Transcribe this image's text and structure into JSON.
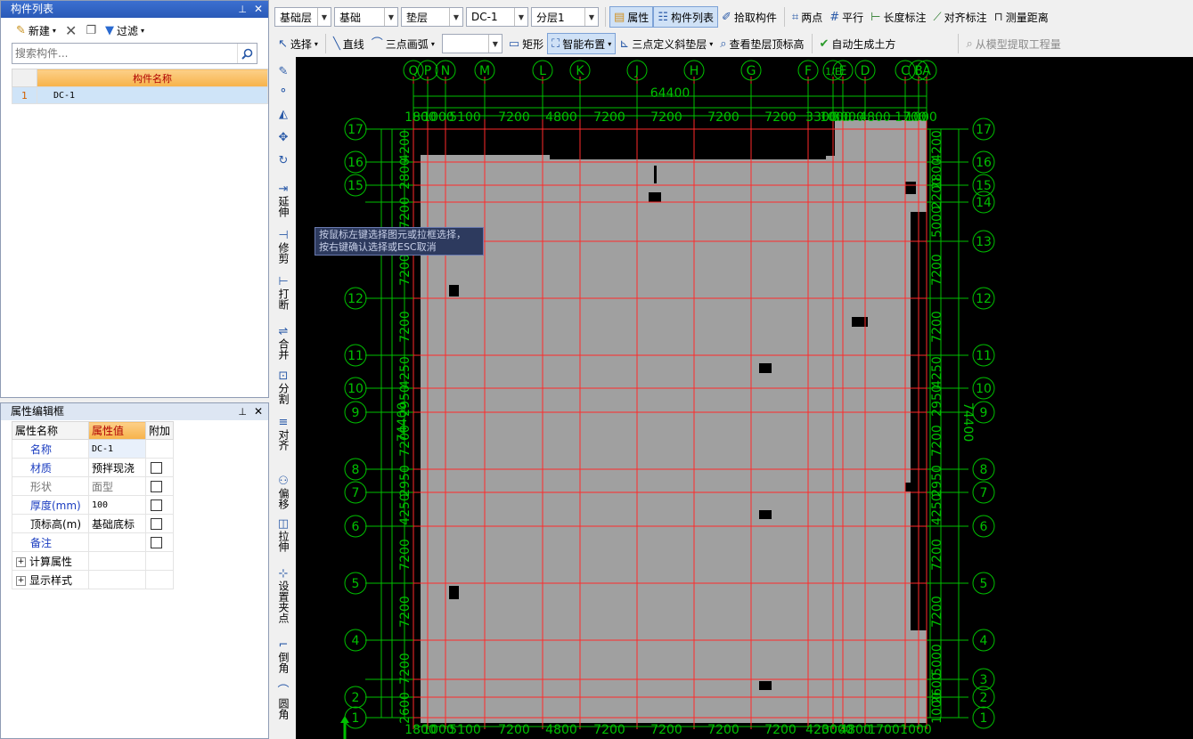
{
  "component_panel": {
    "title": "构件列表",
    "new_label": "新建",
    "filter_label": "过滤",
    "search_placeholder": "搜索构件...",
    "column_header": "构件名称",
    "rows": [
      {
        "index": "1",
        "name": "DC-1"
      }
    ]
  },
  "property_panel": {
    "title": "属性编辑框",
    "headers": {
      "name": "属性名称",
      "value": "属性值",
      "extra": "附加"
    },
    "rows": [
      {
        "name": "名称",
        "value": "DC-1"
      },
      {
        "name": "材质",
        "value": "预拌现浇"
      },
      {
        "name": "形状",
        "value": "面型"
      },
      {
        "name": "厚度(mm)",
        "value": "100"
      },
      {
        "name": "顶标高(m)",
        "value": "基础底标"
      },
      {
        "name": "备注",
        "value": ""
      }
    ],
    "groups": [
      "计算属性",
      "显示样式"
    ]
  },
  "toolbar1": {
    "floor_combo": "基础层",
    "type_combo": "基础",
    "category_combo": "垫层",
    "component_combo": "DC-1",
    "layer_combo": "分层1",
    "property_btn": "属性",
    "comp_list_btn": "构件列表",
    "pick_btn": "拾取构件",
    "two_point_btn": "两点",
    "parallel_btn": "平行",
    "length_dim_btn": "长度标注",
    "align_dim_btn": "对齐标注",
    "measure_btn": "测量距离"
  },
  "toolbar2": {
    "select_btn": "选择",
    "line_btn": "直线",
    "arc_btn": "三点画弧",
    "rect_btn": "矩形",
    "smart_layout_btn": "智能布置",
    "slope_btn": "三点定义斜垫层",
    "view_top_btn": "查看垫层顶标高",
    "auto_earth_btn": "自动生成土方",
    "extract_btn": "从模型提取工程量"
  },
  "vertical_tools": [
    "延伸",
    "修剪",
    "打断",
    "合并",
    "分割",
    "对齐",
    "偏移",
    "拉伸",
    "设置夹点",
    "倒角",
    "圆角"
  ],
  "tooltip": {
    "line1": "按鼠标左键选择图元或拉框选择，",
    "line2": "按右键确认选择或ESC取消"
  },
  "drawing": {
    "top_axes": [
      "Q",
      "P",
      "N",
      "M",
      "L",
      "K",
      "J",
      "H",
      "G",
      "F",
      "1/E",
      "E",
      "D",
      "C",
      "B",
      "A"
    ],
    "row_axes": [
      "17",
      "16",
      "15",
      "14",
      "13",
      "12",
      "11",
      "10",
      "9",
      "8",
      "7",
      "6",
      "5",
      "4",
      "3",
      "2",
      "1"
    ],
    "overall_width": "64400",
    "overall_height": "74400",
    "top_dims": [
      "1800",
      "1000",
      "5100",
      "7200",
      "4800",
      "7200",
      "7200",
      "7200",
      "7200",
      "3300",
      "1000",
      "3000",
      "4800",
      "1700",
      "1000"
    ],
    "bottom_dims": [
      "1800",
      "1000",
      "5100",
      "7200",
      "4800",
      "7200",
      "7200",
      "7200",
      "7200",
      "4200",
      "3000",
      "4800",
      "1700",
      "1000"
    ],
    "left_dims": [
      "4200",
      "2800",
      "7200",
      "7200",
      "7200",
      "4250",
      "2950",
      "7200",
      "2950",
      "4250",
      "7200",
      "7200",
      "7200",
      "2600"
    ],
    "right_dims": [
      "4200",
      "2800",
      "2200",
      "5000",
      "7200",
      "7200",
      "4250",
      "2950",
      "7200",
      "2950",
      "4250",
      "7200",
      "7200",
      "5000",
      "2600",
      "1000"
    ],
    "colors": {
      "grid": "#00c000",
      "axis_line": "#ff2a2a",
      "slab": "#a0a0a0",
      "bg": "#000000"
    }
  }
}
